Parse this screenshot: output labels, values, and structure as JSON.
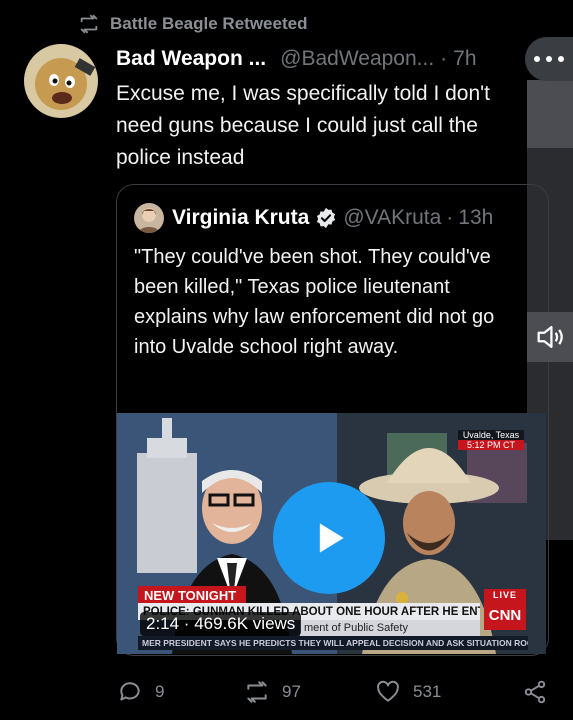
{
  "retweet": {
    "label": "Battle Beagle Retweeted",
    "icon": "retweet-icon"
  },
  "tweet": {
    "display_name": "Bad Weapon ...",
    "handle": "@BadWeapon...",
    "time": "7h",
    "text": "Excuse me, I was specifically told I don't need guns because I could just call the police instead"
  },
  "quoted": {
    "display_name": "Virginia Kruta",
    "handle": "@VAKruta",
    "time": "13h",
    "text": "\"They could've been shot. They could've been killed,\" Texas police lieutenant explains why law enforcement did not go into Uvalde school right away.",
    "media": {
      "duration": "2:14 · 469.6K views",
      "new_tonight": "NEW TONIGHT",
      "headline": "POLICE: GUNMAN KILLED ABOUT ONE HOUR AFTER HE ENTERED SCHOOL",
      "subline": "ment of Public Safety",
      "network": "CNN",
      "live": "LIVE",
      "ticker": "MER PRESIDENT SAYS HE PREDICTS THEY WILL APPEAL DECISION AND ASK  SITUATION ROOM",
      "location": "Uvalde, Texas",
      "location_time": "5:12 PM CT"
    }
  },
  "actions": {
    "replies": "9",
    "retweets": "97",
    "likes": "531"
  },
  "colors": {
    "accent": "#1d9bf0",
    "muted": "#71767b",
    "cnn_red": "#c4161c"
  }
}
